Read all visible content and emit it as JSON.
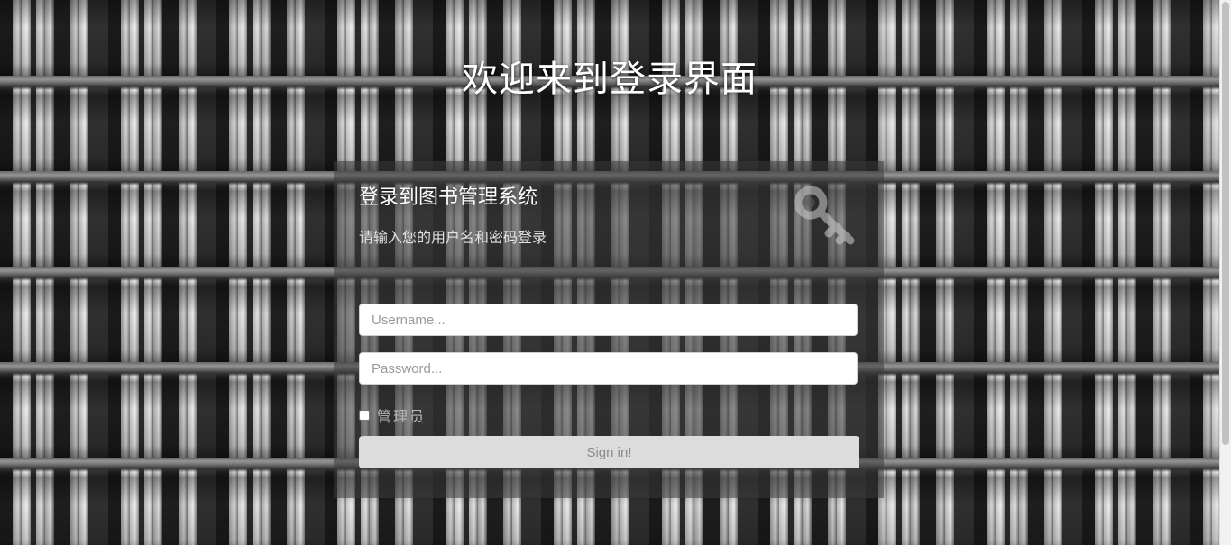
{
  "page": {
    "welcome_title": "欢迎来到登录界面"
  },
  "login_panel": {
    "title": "登录到图书管理系统",
    "subtitle": "请输入您的用户名和密码登录",
    "icon": "key-icon",
    "username_placeholder": "Username...",
    "password_placeholder": "Password...",
    "admin_label": "管理员",
    "admin_checked": false,
    "signin_label": "Sign in!"
  },
  "colors": {
    "title_text": "#ffffff",
    "panel_bg": "rgba(60,60,60,0.55)",
    "button_bg": "#dcdcdc",
    "button_text": "#8a8a8a"
  }
}
